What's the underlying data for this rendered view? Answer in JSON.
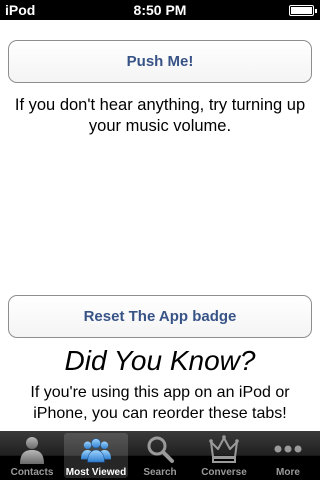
{
  "status_bar": {
    "carrier": "iPod",
    "time": "8:50 PM",
    "battery_level": 1.0
  },
  "main": {
    "push_button_label": "Push Me!",
    "hint_text": "If you don't hear anything, try turning up your music volume.",
    "reset_button_label": "Reset The App badge",
    "did_you_know_title": "Did You Know?",
    "did_you_know_text": "If you're using this app on an iPod or iPhone, you can reorder these tabs!"
  },
  "tab_bar": {
    "selected": "Most Viewed",
    "tabs": [
      {
        "label": "Contacts",
        "icon": "person-icon"
      },
      {
        "label": "Most Viewed",
        "icon": "people-icon"
      },
      {
        "label": "Search",
        "icon": "magnifier-icon"
      },
      {
        "label": "Converse",
        "icon": "crown-icon"
      },
      {
        "label": "More",
        "icon": "more-dots-icon"
      }
    ]
  },
  "colors": {
    "button_text": "#385487",
    "tab_selected_icon": "#4fa3e6"
  }
}
